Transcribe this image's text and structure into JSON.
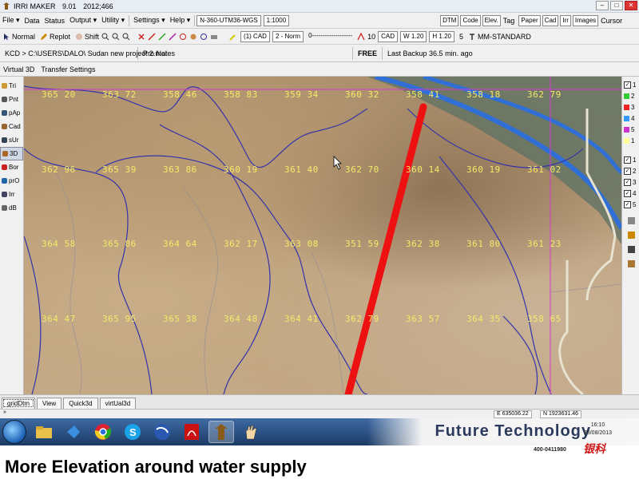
{
  "titlebar": {
    "app": "IRRI MAKER",
    "version": "9.01",
    "build": "2012;466",
    "min": "–",
    "max": "□",
    "close": "✕"
  },
  "menubar": {
    "file": "File ▾",
    "data": "Data",
    "status": "Status",
    "output": "Output ▾",
    "utility": "Utility ▾",
    "settings": "Settings ▾",
    "help": "Help ▾",
    "projection": "N-360-UTM36-WGS",
    "scale": "1:1000",
    "btn_dtm": "DTM",
    "btn_code": "Code",
    "btn_elev": "Elev.",
    "tag": "Tag",
    "btn_paper": "Paper",
    "btn_cad": "Cad",
    "btn_irr": "Irr",
    "btn_images": "Images",
    "cursor": "Cursor"
  },
  "toolbar2": {
    "normal": "Normal",
    "replot": "Replot",
    "shift": "Shift",
    "cad_layer": "(1) CAD",
    "pen": "2 - Norm",
    "linetype": "0-------------------",
    "text_size": "10",
    "cad": "CAD",
    "width": "W 1.20",
    "height": "H 1.20",
    "num": "5",
    "style": "MM-STANDARD"
  },
  "toolbar3": {
    "path": "KCD > C:\\USERS\\DALO\\ Sudan new project 2.mal",
    "pro_notes": "Pro Notes",
    "free": "FREE",
    "backup": "Last Backup 36.5 min. ago"
  },
  "toolbar4": {
    "virtual3d": "Virtual 3D",
    "transfer": "Transfer Settings"
  },
  "left_tools": [
    {
      "label": "Tri",
      "icon": "triangle-icon"
    },
    {
      "label": "Pnt",
      "icon": "point-icon"
    },
    {
      "label": "pAp",
      "icon": "polygon-icon"
    },
    {
      "label": "Cad",
      "icon": "cad-icon"
    },
    {
      "label": "sUr",
      "icon": "survey-icon"
    },
    {
      "label": "3D",
      "icon": "cube-icon"
    },
    {
      "label": "Bor",
      "icon": "border-icon"
    },
    {
      "label": "prO",
      "icon": "profile-icon"
    },
    {
      "label": "Irr",
      "icon": "irrigation-icon"
    },
    {
      "label": "dB",
      "icon": "hash-icon"
    }
  ],
  "layers": [
    {
      "label": "1",
      "color": "#ffff66",
      "checked": true
    },
    {
      "label": "2",
      "color": "#33cc33"
    },
    {
      "label": "3",
      "color": "#ee2222"
    },
    {
      "label": "4",
      "color": "#3399ff"
    },
    {
      "label": "5",
      "color": "#cc33cc"
    },
    {
      "label": "1",
      "color": "#ffff99"
    }
  ],
  "layer_checks": [
    "1",
    "2",
    "3",
    "4",
    "5"
  ],
  "elevations": [
    [
      "365 20",
      "363 72",
      "358 46",
      "358 83",
      "359 34",
      "360 32",
      "358 41",
      "358 18",
      "362 79"
    ],
    [
      "362 96",
      "365 39",
      "363 86",
      "360 19",
      "361 40",
      "362 70",
      "360 14",
      "360 19",
      "361 02"
    ],
    [
      "364 58",
      "365 86",
      "364 64",
      "362 17",
      "363 08",
      "351 59",
      "362 38",
      "361 80",
      "361 23"
    ],
    [
      "364 47",
      "365 95",
      "365 38",
      "364 48",
      "364 41",
      "362 79",
      "363 57",
      "364 35",
      "358 65"
    ]
  ],
  "tabs": [
    "gridDtm",
    "View",
    "Quick3d",
    "virtUal3d"
  ],
  "status": {
    "prefix": "»",
    "easting": "E 635036.22",
    "northing": "N 1923631.46"
  },
  "taskbar": {
    "banner": "Future Technology",
    "time": "16:10",
    "date": "28/08/2013"
  },
  "phone": "400-0411980",
  "brand_cn": "银科",
  "caption": "More Elevation around water supply"
}
